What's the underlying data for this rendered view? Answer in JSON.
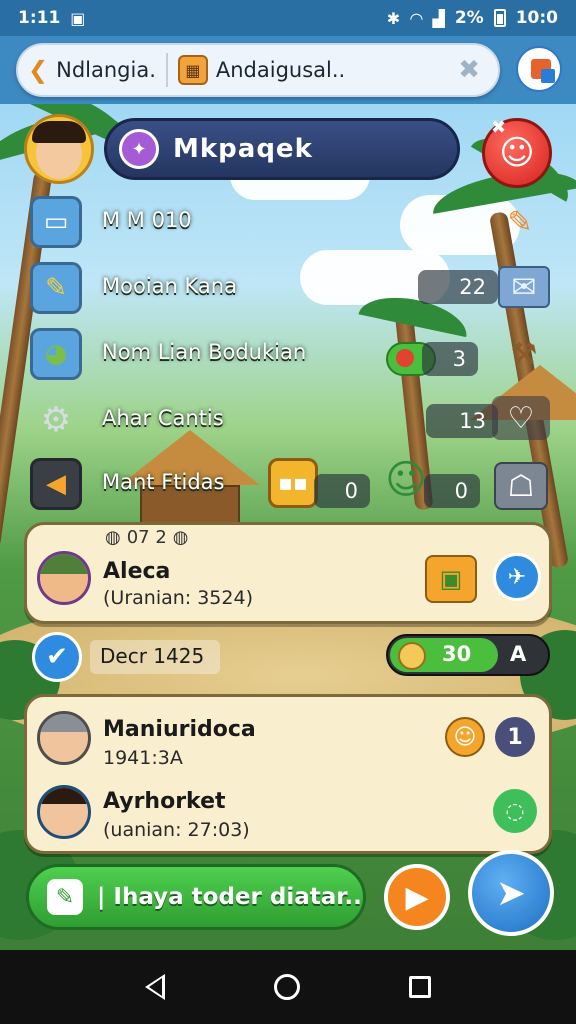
{
  "status_bar": {
    "time": "1:11",
    "battery": "2%",
    "clock": "10:0"
  },
  "tabs": [
    {
      "label": "Ndlangia."
    },
    {
      "label": "Andaigusal.."
    }
  ],
  "header": {
    "title": "Mkpaqek"
  },
  "menu": [
    {
      "label": "M M 010"
    },
    {
      "label": "Mooian Kana",
      "count": "22"
    },
    {
      "label": "Nom Lian Bodukian",
      "count": "3"
    },
    {
      "label": "Ahar Cantis",
      "count": "13"
    },
    {
      "label": "Mant Ftidas",
      "count_a": "0",
      "count_b": "0"
    }
  ],
  "card1": {
    "top_label": "07 2",
    "name": "Aleca",
    "sub": "(Uranian: 3524)"
  },
  "progress_row": {
    "label": "Decr 1425",
    "value": "30",
    "suffix": "A"
  },
  "card2": {
    "row1": {
      "name": "Maniuridoca",
      "sub": "1941:3A",
      "badge": "1"
    },
    "row2": {
      "name": "Ayrhorket",
      "sub": "(uanian: 27:03)"
    }
  },
  "action_bar": {
    "label": "| Ihaya toder diatar.."
  },
  "colors": {
    "accent_blue": "#2a6fa3",
    "card_bg": "#f9efcf",
    "green": "#4bbf3d",
    "red": "#d6211e"
  }
}
